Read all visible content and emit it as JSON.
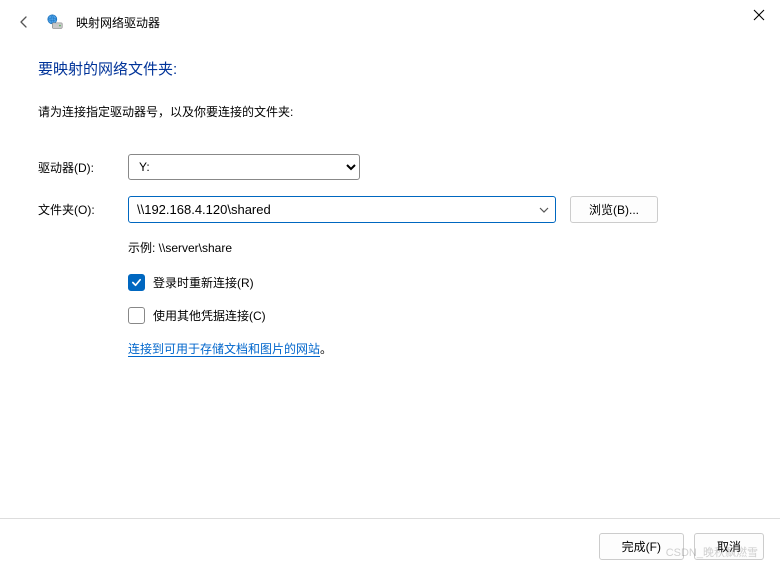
{
  "window": {
    "title": "映射网络驱动器"
  },
  "main": {
    "heading": "要映射的网络文件夹:",
    "instruction": "请为连接指定驱动器号，以及你要连接的文件夹:",
    "drive_label": "驱动器(D):",
    "drive_value": "Y:",
    "folder_label": "文件夹(O):",
    "folder_value": "\\\\192.168.4.120\\shared",
    "browse_label": "浏览(B)...",
    "example": "示例: \\\\server\\share",
    "reconnect_label": "登录时重新连接(R)",
    "reconnect_checked": true,
    "othercreds_label": "使用其他凭据连接(C)",
    "othercreds_checked": false,
    "link_text": "连接到可用于存储文档和图片的网站",
    "link_period": "。"
  },
  "footer": {
    "finish": "完成(F)",
    "cancel": "取消"
  },
  "watermark": "CSDN_晚秋飘燃雪"
}
